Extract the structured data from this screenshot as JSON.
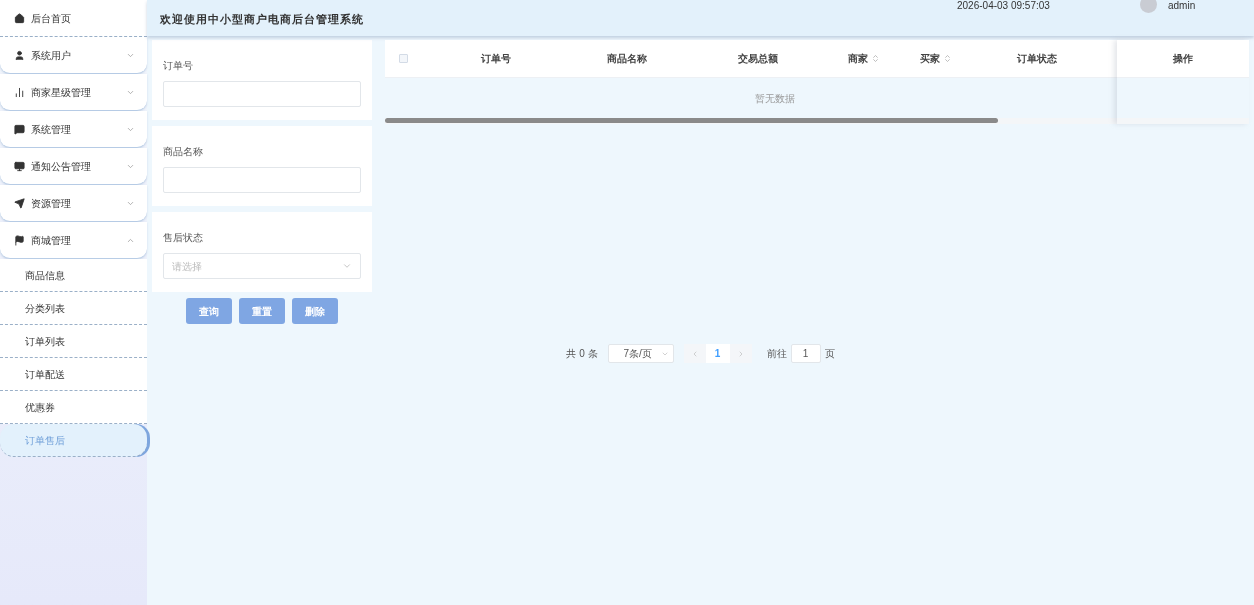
{
  "sidebar": {
    "items": [
      {
        "kind": "link",
        "label": "后台首页"
      },
      {
        "kind": "menu",
        "label": "系统用户",
        "expanded": false
      },
      {
        "kind": "menu",
        "label": "商家星级管理",
        "expanded": false
      },
      {
        "kind": "menu",
        "label": "系统管理",
        "expanded": false
      },
      {
        "kind": "menu",
        "label": "通知公告管理",
        "expanded": false
      },
      {
        "kind": "menu",
        "label": "资源管理",
        "expanded": false
      },
      {
        "kind": "menu",
        "label": "商城管理",
        "expanded": true,
        "children": [
          {
            "label": "商品信息",
            "selected": false
          },
          {
            "label": "分类列表",
            "selected": false
          },
          {
            "label": "订单列表",
            "selected": false
          },
          {
            "label": "订单配送",
            "selected": false
          },
          {
            "label": "优惠券",
            "selected": false
          },
          {
            "label": "订单售后",
            "selected": true
          }
        ]
      }
    ]
  },
  "header": {
    "title": "欢迎使用中小型商户电商后台管理系统",
    "datetime": "2026-04-03 09:57:03",
    "user": "admin"
  },
  "filters": [
    {
      "kind": "input",
      "label": "订单号"
    },
    {
      "kind": "input",
      "label": "商品名称"
    },
    {
      "kind": "select",
      "label": "售后状态",
      "placeholder": "请选择"
    }
  ],
  "buttons": [
    "查询",
    "重置",
    "删除"
  ],
  "table": {
    "select_all": {
      "checked": false
    },
    "columns": [
      {
        "label": "订单号",
        "sortable": false
      },
      {
        "label": "商品名称",
        "sortable": false
      },
      {
        "label": "交易总额",
        "sortable": false
      },
      {
        "label": "商家",
        "sortable": true
      },
      {
        "label": "买家",
        "sortable": true
      },
      {
        "label": "订单状态",
        "sortable": false
      }
    ],
    "fixed_column": "操作",
    "empty_text": "暂无数据"
  },
  "pagination": {
    "total": "共 0 条",
    "page_size": "7条/页",
    "pages": [
      {
        "label": "1",
        "selected": true
      }
    ],
    "goto_label": "前往",
    "goto_value": "1",
    "goto_suffix": "页"
  }
}
